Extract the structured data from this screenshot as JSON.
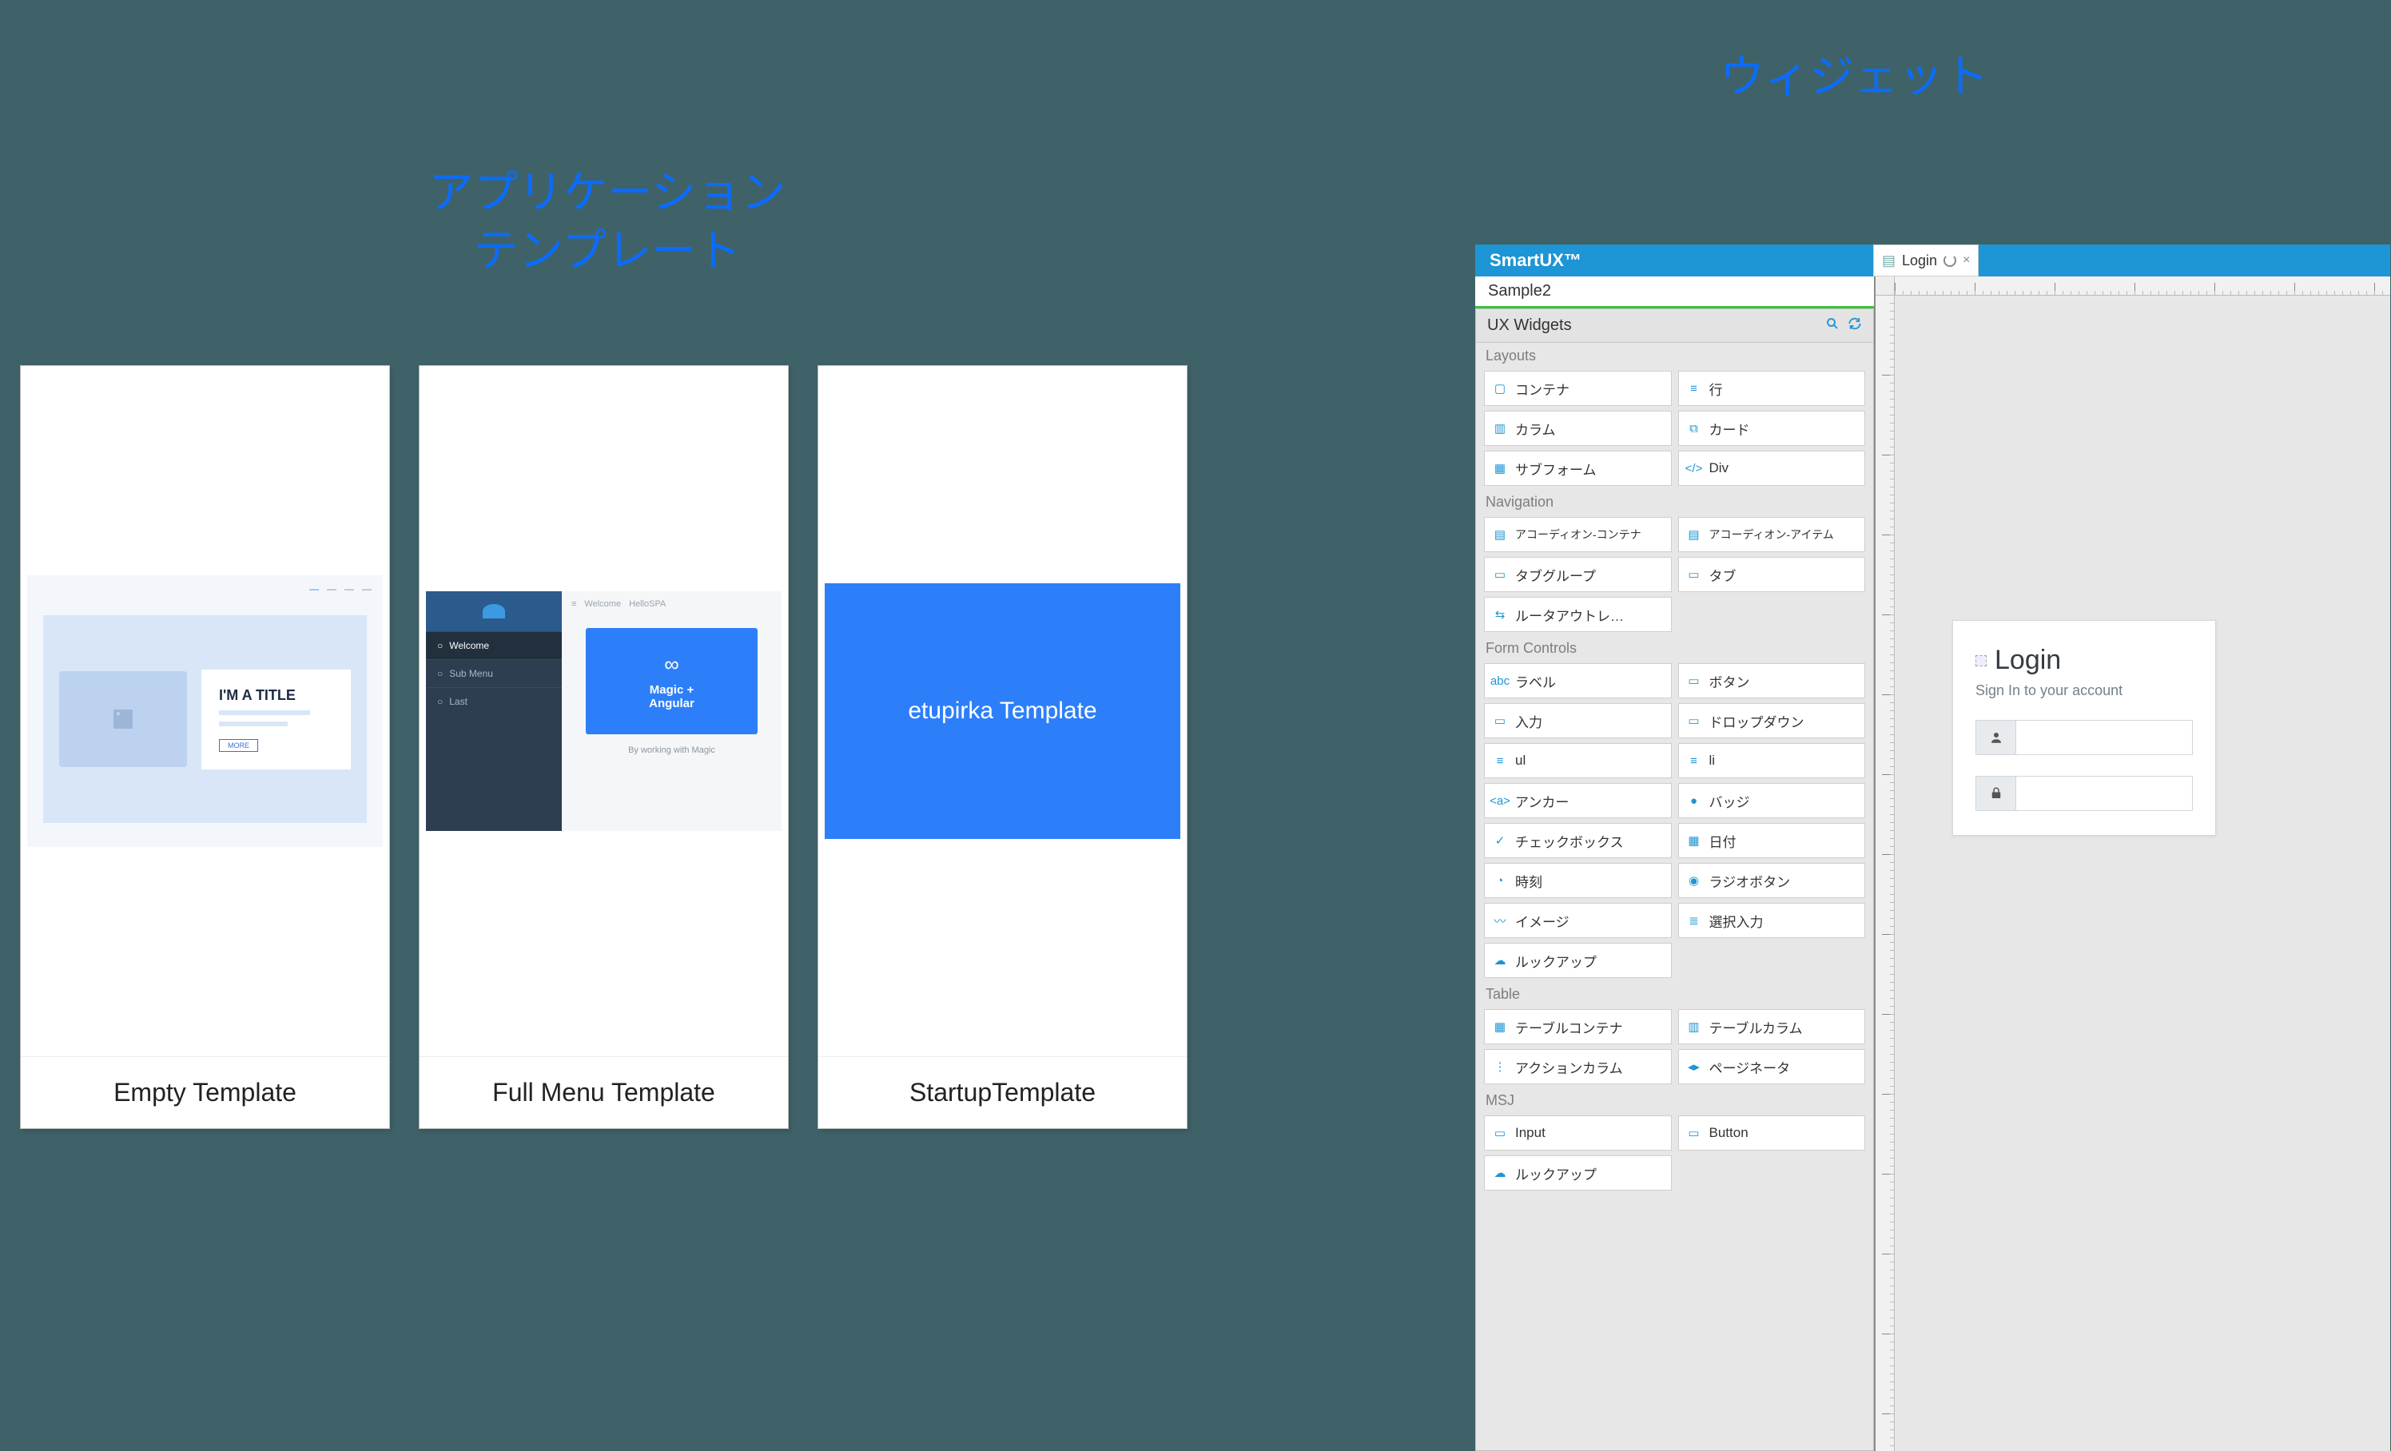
{
  "labels": {
    "app": "アプリケーション\nテンプレート",
    "widget": "ウィジェット"
  },
  "templates": [
    {
      "name": "Empty Template"
    },
    {
      "name": "Full Menu Template"
    },
    {
      "name": "StartupTemplate"
    }
  ],
  "emptyPreview": {
    "title": "I'M A TITLE",
    "button": "MORE",
    "tabs": [
      "",
      "",
      "",
      ""
    ]
  },
  "fullPreview": {
    "top": {
      "menu": "≡",
      "t1": "Welcome",
      "t2": "HelloSPA"
    },
    "side": [
      "Welcome",
      "Sub Menu",
      "Last"
    ],
    "card": {
      "icon": "∞",
      "l1": "Magic +",
      "l2": "Angular"
    },
    "foot": "By working with Magic"
  },
  "startupPreview": {
    "text": "etupirka Template"
  },
  "editor": {
    "brand": "SmartUX™",
    "tab": "Login",
    "project": "Sample2",
    "paletteTitle": "UX Widgets",
    "sections": {
      "layouts": {
        "title": "Layouts",
        "items": [
          "コンテナ",
          "行",
          "カラム",
          "カード",
          "サブフォーム",
          "Div"
        ]
      },
      "navigation": {
        "title": "Navigation",
        "items": [
          "アコーディオン-コンテナ",
          "アコーディオン-アイテム",
          "タブグループ",
          "タブ",
          "ルータアウトレ…"
        ]
      },
      "form": {
        "title": "Form Controls",
        "items": [
          "ラベル",
          "ボタン",
          "入力",
          "ドロップダウン",
          "ul",
          "li",
          "アンカー",
          "バッジ",
          "チェックボックス",
          "日付",
          "時刻",
          "ラジオボタン",
          "イメージ",
          "選択入力",
          "ルックアップ"
        ]
      },
      "table": {
        "title": "Table",
        "items": [
          "テーブルコンテナ",
          "テーブルカラム",
          "アクションカラム",
          "ページネータ"
        ]
      },
      "msj": {
        "title": "MSJ",
        "items": [
          "Input",
          "Button",
          "ルックアップ"
        ]
      }
    }
  },
  "login": {
    "title": "Login",
    "sub": "Sign In to your account"
  },
  "icons": {
    "layouts": [
      "▢",
      "≡",
      "▥",
      "⧉",
      "▦",
      "</>"
    ],
    "navigation": [
      "▤",
      "▤",
      "▭",
      "▭",
      "⇆"
    ],
    "form": [
      "abc",
      "▭",
      "▭",
      "▭",
      "≡",
      "≡",
      "<a>",
      "●",
      "✓",
      "▦",
      "◔",
      "◉",
      "〰",
      "≣",
      "☁"
    ],
    "table": [
      "▦",
      "▥",
      "⋮",
      "◂▸"
    ],
    "msj": [
      "▭",
      "▭",
      "☁"
    ]
  }
}
